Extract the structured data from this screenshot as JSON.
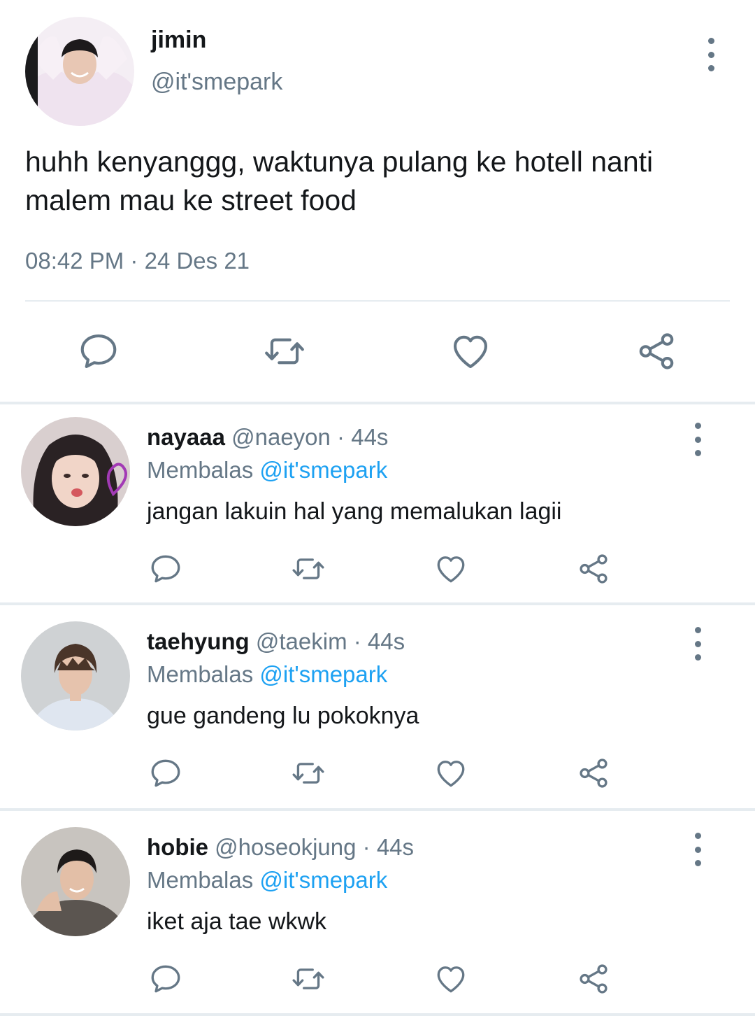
{
  "main_tweet": {
    "name": "jimin",
    "handle": "@it'smepark",
    "text": "huhh kenyanggg, waktunya pulang ke hotell nanti malem mau ke street food",
    "time": "08:42 PM",
    "separator": "·",
    "date": "24 Des 21",
    "actions": {
      "reply_icon": "comment-bubble-icon",
      "retweet_icon": "retweet-arrows-icon",
      "like_icon": "heart-icon",
      "share_icon": "share-nodes-icon"
    }
  },
  "replies": [
    {
      "name": "nayaaa",
      "handle": "@naeyon",
      "dot": "·",
      "time": "44s",
      "replying_label": "Membalas",
      "replying_to": "@it'smepark",
      "text": "jangan lakuin hal yang memalukan lagii"
    },
    {
      "name": "taehyung",
      "handle": "@taekim",
      "dot": "·",
      "time": "44s",
      "replying_label": "Membalas",
      "replying_to": "@it'smepark",
      "text": "gue gandeng lu pokoknya"
    },
    {
      "name": "hobie",
      "handle": "@hoseokjung",
      "dot": "·",
      "time": "44s",
      "replying_label": "Membalas",
      "replying_to": "@it'smepark",
      "text": "iket aja tae wkwk"
    }
  ],
  "colors": {
    "text_primary": "#14171a",
    "text_secondary": "#657786",
    "link": "#1da1f2",
    "divider": "#e6ecf0"
  }
}
